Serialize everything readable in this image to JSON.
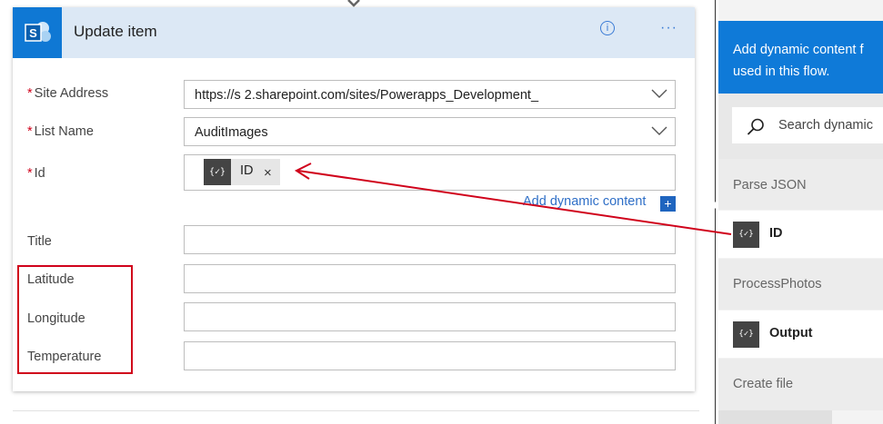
{
  "card": {
    "title": "Update item",
    "info_icon": "info-icon",
    "more_icon": "ellipsis-icon",
    "more_label": "···",
    "info_label": "i",
    "fields": {
      "site_address": {
        "label": "Site Address",
        "required_mark": "*",
        "value": "https://s       2.sharepoint.com/sites/Powerapps_Development_",
        "control": "dropdown"
      },
      "list_name": {
        "label": "List Name",
        "required_mark": "*",
        "value": "AuditImages",
        "control": "dropdown"
      },
      "id": {
        "label": "Id",
        "required_mark": "*",
        "token": {
          "icon": "{✓}",
          "label": "ID",
          "remove": "×"
        }
      },
      "title": {
        "label": "Title",
        "value": ""
      },
      "latitude": {
        "label": "Latitude",
        "value": ""
      },
      "longitude": {
        "label": "Longitude",
        "value": ""
      },
      "temperature": {
        "label": "Temperature",
        "value": ""
      }
    },
    "add_dynamic_content": "Add dynamic content",
    "add_dynamic_plus": "+"
  },
  "panel": {
    "header_text_line1": "Add dynamic content f",
    "header_text_line2": "used in this flow.",
    "search_placeholder": "Search dynamic",
    "groups": [
      {
        "header": "Parse JSON",
        "items": [
          {
            "icon": "{✓}",
            "label": "ID"
          }
        ]
      },
      {
        "header": "ProcessPhotos",
        "items": [
          {
            "icon": "{✓}",
            "label": "Output"
          }
        ]
      },
      {
        "header": "Create file",
        "items": []
      }
    ]
  },
  "colors": {
    "accent": "#0f78d4",
    "header_bg": "#dce8f5",
    "annotation_red": "#d0021b",
    "link_blue": "#2f6fc7"
  }
}
